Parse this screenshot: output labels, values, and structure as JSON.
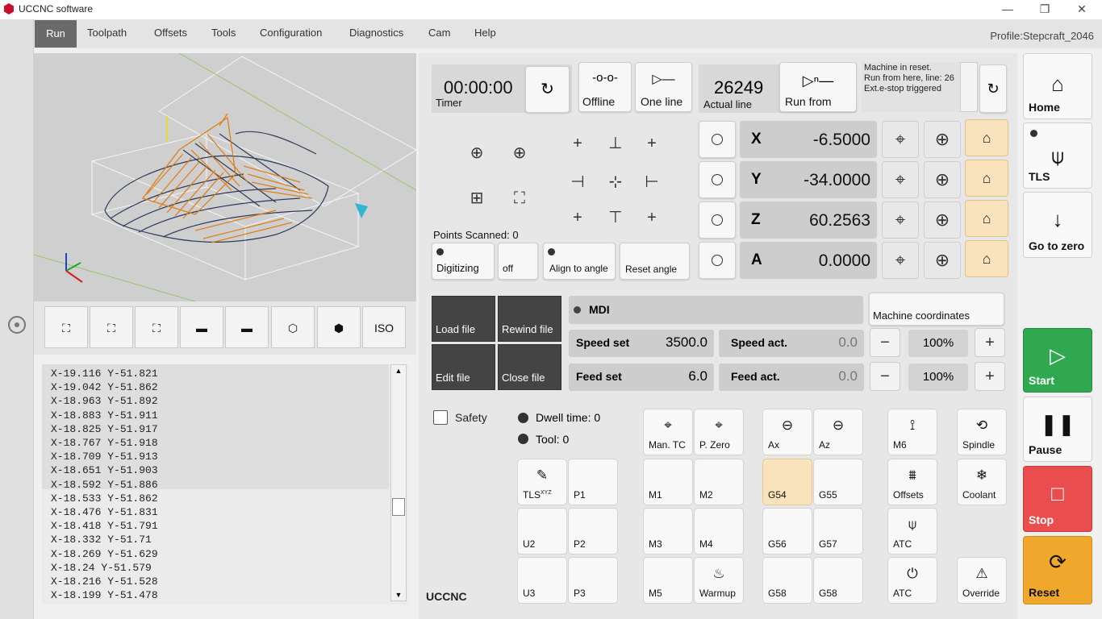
{
  "window": {
    "title": "UCCNC software",
    "minimize": "—",
    "restore": "❐",
    "close": "✕"
  },
  "menu": {
    "items": [
      "Run",
      "Toolpath",
      "Offsets",
      "Tools",
      "Configuration",
      "Diagnostics",
      "Cam",
      "Help"
    ],
    "active": "Run",
    "profile": "Profile:Stepcraft_2046"
  },
  "view_toolbar": {
    "buttons": [
      "⛶",
      "⛶",
      "⛶",
      "▬",
      "▬",
      "⬡",
      "⬢",
      "ISO"
    ]
  },
  "gcode": {
    "lines": [
      "X-19.116 Y-51.821",
      "X-19.042 Y-51.862",
      "X-18.963 Y-51.892",
      "X-18.883 Y-51.911",
      "X-18.825 Y-51.917",
      "X-18.767 Y-51.918",
      "X-18.709 Y-51.913",
      "X-18.651 Y-51.903",
      "X-18.592 Y-51.886",
      "X-18.533 Y-51.862",
      "X-18.476 Y-51.831",
      "X-18.418 Y-51.791",
      "X-18.332 Y-51.71",
      "X-18.269 Y-51.629",
      "X-18.24 Y-51.579",
      "X-18.216 Y-51.528",
      "X-18.199 Y-51.478"
    ]
  },
  "timer": {
    "value": "00:00:00",
    "label": "Timer"
  },
  "buttons": {
    "offline": "Offline",
    "one_line": "One line",
    "run_from": "Run from",
    "load_file": "Load file",
    "rewind_file": "Rewind file",
    "edit_file": "Edit file",
    "close_file": "Close file",
    "digitizing": "Digitizing",
    "off": "off",
    "align_to_angle": "Align to angle",
    "reset_angle": "Reset angle",
    "mdi": "MDI",
    "machine_coordinates": "Machine coordinates",
    "minus": "−",
    "plus": "+",
    "safety": "Safety"
  },
  "line": {
    "value": "26249",
    "label": "Actual line"
  },
  "status": {
    "lines": [
      "Machine in reset.",
      "Run from here, line: 26",
      "Ext.e-stop triggered"
    ]
  },
  "points_scanned": {
    "label": "Points Scanned:",
    "value": "0"
  },
  "axes": [
    {
      "name": "X",
      "value": "-6.5000"
    },
    {
      "name": "Y",
      "value": "-34.0000"
    },
    {
      "name": "Z",
      "value": "60.2563"
    },
    {
      "name": "A",
      "value": "0.0000"
    }
  ],
  "speed": {
    "set_label": "Speed set",
    "set_value": "3500.0",
    "act_label": "Speed act.",
    "act_value": "0.0",
    "override": "100%"
  },
  "feed": {
    "set_label": "Feed set",
    "set_value": "6.0",
    "act_label": "Feed act.",
    "act_value": "0.0",
    "override": "100%"
  },
  "dwell": {
    "label": "Dwell time:",
    "value": "0"
  },
  "tool": {
    "label": "Tool:",
    "value": "0"
  },
  "grid_buttons": [
    {
      "id": "man-tc",
      "label": "Man. TC",
      "icon": "⌖"
    },
    {
      "id": "p-zero",
      "label": "P. Zero",
      "icon": "⌖"
    },
    {
      "id": "ax",
      "label": "Ax",
      "icon": "⊖"
    },
    {
      "id": "az",
      "label": "Az",
      "icon": "⊖"
    },
    {
      "id": "m6",
      "label": "M6",
      "icon": "⟟"
    },
    {
      "id": "spindle",
      "label": "Spindle",
      "icon": "⟲"
    },
    {
      "id": "tls-xyz",
      "label": "TLS",
      "sup": "XYZ",
      "icon": "✎"
    },
    {
      "id": "p1",
      "label": "P1",
      "icon": ""
    },
    {
      "id": "m1",
      "label": "M1",
      "icon": ""
    },
    {
      "id": "m2",
      "label": "M2",
      "icon": ""
    },
    {
      "id": "g54",
      "label": "G54",
      "icon": ""
    },
    {
      "id": "g55",
      "label": "G55",
      "icon": ""
    },
    {
      "id": "offsets",
      "label": "Offsets",
      "icon": "⩩"
    },
    {
      "id": "coolant",
      "label": "Coolant",
      "icon": "❄"
    },
    {
      "id": "u2",
      "label": "U2",
      "icon": ""
    },
    {
      "id": "p2",
      "label": "P2",
      "icon": ""
    },
    {
      "id": "m3",
      "label": "M3",
      "icon": ""
    },
    {
      "id": "m4",
      "label": "M4",
      "icon": ""
    },
    {
      "id": "g56",
      "label": "G56",
      "icon": ""
    },
    {
      "id": "g57",
      "label": "G57",
      "icon": ""
    },
    {
      "id": "atc1",
      "label": "ATC",
      "icon": "⍦"
    },
    {
      "id": "u3",
      "label": "U3",
      "icon": ""
    },
    {
      "id": "p3",
      "label": "P3",
      "icon": ""
    },
    {
      "id": "m5",
      "label": "M5",
      "icon": ""
    },
    {
      "id": "warmup",
      "label": "Warmup",
      "icon": "♨"
    },
    {
      "id": "g58a",
      "label": "G58",
      "icon": ""
    },
    {
      "id": "g58b",
      "label": "G58",
      "icon": ""
    },
    {
      "id": "atc2",
      "label": "ATC",
      "icon": "⏻"
    },
    {
      "id": "override",
      "label": "Override",
      "icon": "⚠"
    }
  ],
  "brand": "UCCNC",
  "side": {
    "home": "Home",
    "tls": "TLS",
    "goto_zero": "Go to zero",
    "start": "Start",
    "pause": "Pause",
    "stop": "Stop",
    "reset": "Reset"
  },
  "colors": {
    "start": "#2fa84f",
    "stop": "#e94d4d",
    "reset": "#f0a82c",
    "accent_orange": "#f9e3bc",
    "toolpath": "#e07b10"
  }
}
